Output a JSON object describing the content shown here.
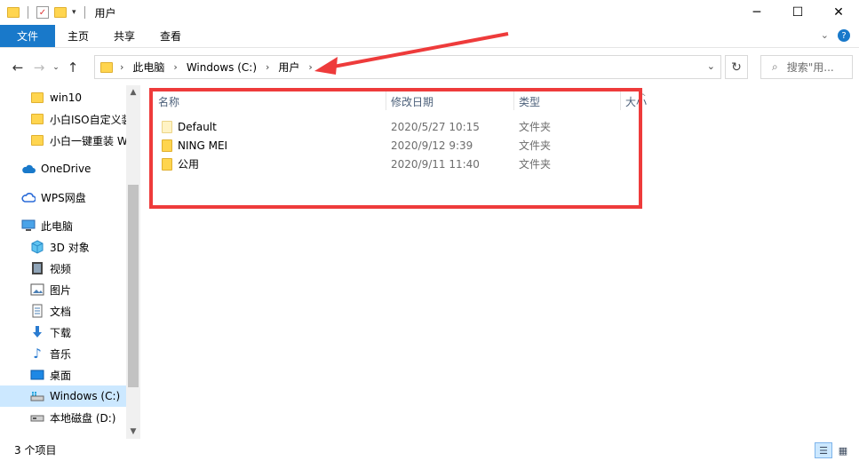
{
  "window": {
    "title": "用户",
    "controls": {
      "minimize": "─",
      "maximize": "☐",
      "close": "✕"
    }
  },
  "ribbon": {
    "tabs": [
      "文件",
      "主页",
      "共享",
      "查看"
    ],
    "help": "?"
  },
  "address": {
    "crumbs": [
      "此电脑",
      "Windows (C:)",
      "用户"
    ],
    "search_placeholder": "搜索\"用..."
  },
  "sidebar": {
    "items": [
      {
        "label": "win10",
        "icon": "folder-icon"
      },
      {
        "label": "小白ISO自定义装",
        "icon": "folder-icon"
      },
      {
        "label": "小白一键重装 W",
        "icon": "folder-icon"
      },
      {
        "label": "OneDrive",
        "icon": "cloud-icon"
      },
      {
        "label": "WPS网盘",
        "icon": "wps-cloud-icon"
      },
      {
        "label": "此电脑",
        "icon": "computer-icon"
      },
      {
        "label": "3D 对象",
        "icon": "cube-icon"
      },
      {
        "label": "视频",
        "icon": "video-icon"
      },
      {
        "label": "图片",
        "icon": "picture-icon"
      },
      {
        "label": "文档",
        "icon": "document-icon"
      },
      {
        "label": "下载",
        "icon": "download-icon"
      },
      {
        "label": "音乐",
        "icon": "music-icon"
      },
      {
        "label": "桌面",
        "icon": "desktop-icon"
      },
      {
        "label": "Windows (C:)",
        "icon": "system-drive-icon",
        "selected": true
      },
      {
        "label": "本地磁盘 (D:)",
        "icon": "drive-icon"
      }
    ]
  },
  "columns": {
    "name": "名称",
    "date": "修改日期",
    "type": "类型",
    "size": "大小"
  },
  "files": [
    {
      "name": "Default",
      "date": "2020/5/27 10:15",
      "type": "文件夹",
      "hidden": true
    },
    {
      "name": "NING MEI",
      "date": "2020/9/12 9:39",
      "type": "文件夹",
      "hidden": false
    },
    {
      "name": "公用",
      "date": "2020/9/11 11:40",
      "type": "文件夹",
      "hidden": false
    }
  ],
  "status": {
    "count": "3 个项目"
  },
  "colors": {
    "accent": "#1979ca",
    "selection": "#cce8ff",
    "folder": "#ffd54f",
    "annotation": "#ee3b3b"
  }
}
